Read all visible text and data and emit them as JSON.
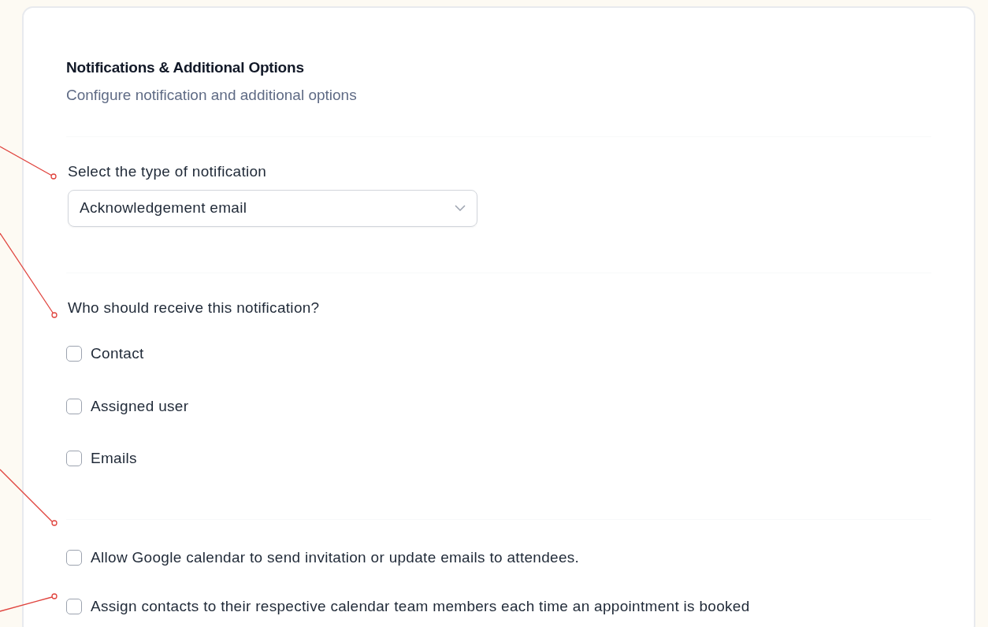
{
  "section": {
    "title": "Notifications & Additional Options",
    "subtitle": "Configure notification and additional options"
  },
  "notification_type": {
    "label": "Select the type of notification",
    "value": "Acknowledgement email"
  },
  "recipients": {
    "question": "Who should receive this notification?",
    "options": [
      {
        "label": "Contact",
        "checked": false
      },
      {
        "label": "Assigned user",
        "checked": false
      },
      {
        "label": "Emails",
        "checked": false
      }
    ]
  },
  "additional_options": [
    {
      "label": "Allow Google calendar to send invitation or update emails to attendees.",
      "checked": false
    },
    {
      "label": "Assign contacts to their respective calendar team members each time an appointment is booked",
      "checked": false
    }
  ]
}
